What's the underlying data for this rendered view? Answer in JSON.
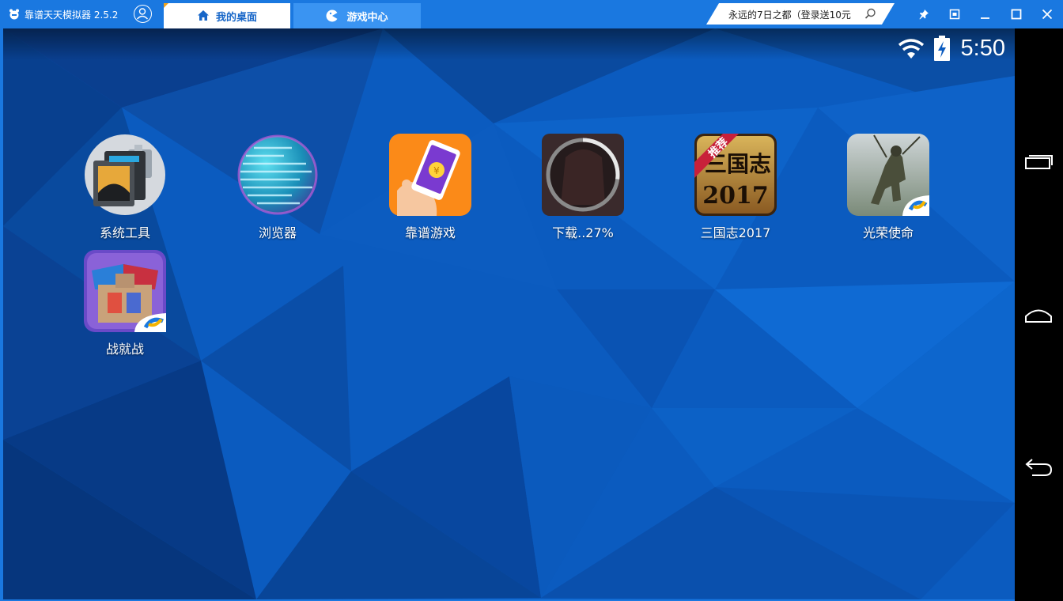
{
  "titlebar": {
    "app_title": "靠谱天天模拟器 2.5.2",
    "tabs": [
      {
        "label": "我的桌面",
        "icon": "home-icon",
        "active": true
      },
      {
        "label": "游戏中心",
        "icon": "gamepad-icon",
        "active": false
      }
    ],
    "promo_text": "永远的7日之都（登录送10元",
    "controls": [
      "pin-icon",
      "restore-window-icon",
      "minimize-icon",
      "maximize-icon",
      "close-icon"
    ],
    "accent_color": "#1a78e0"
  },
  "statusbar": {
    "clock": "5:50",
    "icons": [
      "wifi-icon",
      "battery-charging-icon"
    ]
  },
  "apps": [
    {
      "label": "系统工具",
      "icon": "system-tools-icon"
    },
    {
      "label": "浏览器",
      "icon": "browser-globe-icon"
    },
    {
      "label": "靠谱游戏",
      "icon": "kaopu-games-icon"
    },
    {
      "label": "下载..27%",
      "icon": "downloading-app-icon",
      "progress": 0.27
    },
    {
      "label": "三国志2017",
      "icon": "sanguozhi-2017-icon",
      "badge": "推荐",
      "icon_text": "三国志",
      "icon_year": "2017"
    },
    {
      "label": "光荣使命",
      "icon": "guangrong-shiming-icon"
    },
    {
      "label": "战就战",
      "icon": "zhanjiuzhan-icon"
    }
  ],
  "navbar": {
    "buttons": [
      "recent-apps-icon",
      "home-nav-icon",
      "back-icon"
    ]
  }
}
